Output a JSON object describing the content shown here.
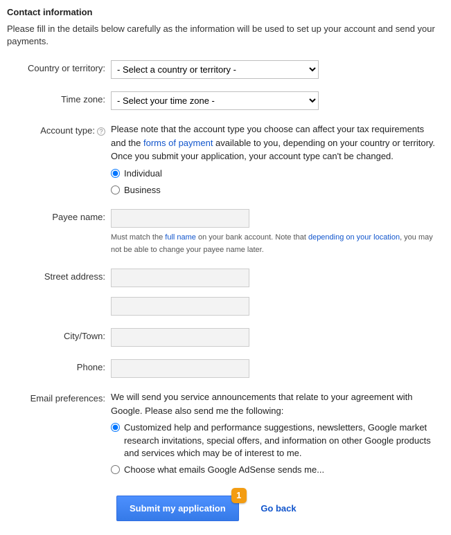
{
  "heading": "Contact information",
  "intro": "Please fill in the details below carefully as the information will be used to set up your account and send your payments.",
  "fields": {
    "country": {
      "label": "Country or territory:",
      "placeholder": "- Select a country or territory -"
    },
    "timezone": {
      "label": "Time zone:",
      "placeholder": "- Select your time zone -"
    },
    "accountType": {
      "label": "Account type:",
      "note_before": "Please note that the account type you choose can affect your tax requirements and the ",
      "note_link": "forms of payment",
      "note_after": " available to you, depending on your country or territory. Once you submit your application, your account type can't be changed.",
      "options": {
        "individual": "Individual",
        "business": "Business"
      }
    },
    "payee": {
      "label": "Payee name:",
      "hint_a": "Must match the ",
      "hint_link1": "full name",
      "hint_b": " on your bank account. Note that ",
      "hint_link2": "depending on your location",
      "hint_c": ", you may not be able to change your payee name later."
    },
    "street": {
      "label": "Street address:"
    },
    "city": {
      "label": "City/Town:"
    },
    "phone": {
      "label": "Phone:"
    },
    "emailPrefs": {
      "label": "Email preferences:",
      "intro": "We will send you service announcements that relate to your agreement with Google. Please also send me the following:",
      "opt1": "Customized help and performance suggestions, newsletters, Google market research invitations, special offers, and information on other Google products and services which may be of interest to me.",
      "opt2": "Choose what emails Google AdSense sends me..."
    }
  },
  "actions": {
    "submit": "Submit my application",
    "badge": "1",
    "goBack": "Go back"
  }
}
